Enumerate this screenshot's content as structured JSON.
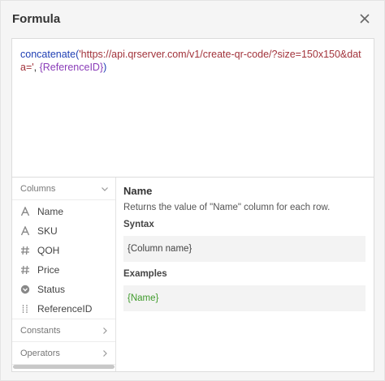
{
  "dialog": {
    "title": "Formula",
    "close_icon": "close-icon"
  },
  "formula": {
    "fn_name": "concatenate",
    "paren_open": "(",
    "string_literal": "'https://api.qrserver.com/v1/create-qr-code/?size=150x150&data='",
    "separator": ", ",
    "column_ref": "{ReferenceID}",
    "paren_close": ")"
  },
  "sidebar": {
    "columns_label": "Columns",
    "columns": [
      {
        "label": "Name",
        "icon": "text-icon"
      },
      {
        "label": "SKU",
        "icon": "text-icon"
      },
      {
        "label": "QOH",
        "icon": "number-icon"
      },
      {
        "label": "Price",
        "icon": "number-icon"
      },
      {
        "label": "Status",
        "icon": "status-icon"
      },
      {
        "label": "ReferenceID",
        "icon": "id-icon"
      }
    ],
    "constants_label": "Constants",
    "operators_label": "Operators"
  },
  "help": {
    "title": "Name",
    "description": "Returns the value of \"Name\" column for each row.",
    "syntax_label": "Syntax",
    "syntax_value": "{Column name}",
    "examples_label": "Examples",
    "example_value": "{Name}"
  },
  "colors": {
    "function": "#1f3fb4",
    "string": "#a2333b",
    "column": "#8a3db8",
    "example": "#3f9b2b"
  }
}
